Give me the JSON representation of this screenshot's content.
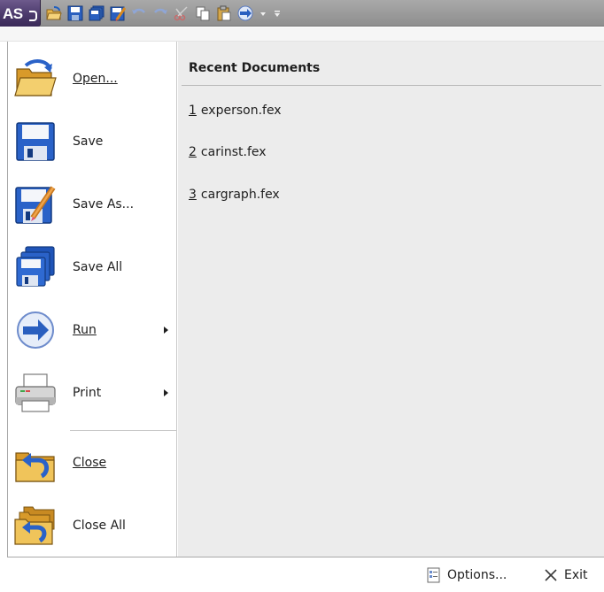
{
  "app": {
    "logo_text": "AS"
  },
  "toolbar": {
    "icons": [
      "open-icon",
      "save-icon",
      "save-all-icon",
      "save-as-icon",
      "undo-icon",
      "redo-icon",
      "cut-icon",
      "copy-icon",
      "paste-icon",
      "run-icon",
      "dropdown-icon",
      "customize-icon"
    ]
  },
  "commands": [
    {
      "id": "open",
      "label": "Open...",
      "mnemonic_index": 0,
      "icon": "folder-open-icon",
      "submenu": false
    },
    {
      "id": "save",
      "label": "Save",
      "mnemonic_index": 0,
      "icon": "floppy-disk-icon",
      "submenu": false
    },
    {
      "id": "save-as",
      "label": "Save As...",
      "mnemonic_index": 5,
      "icon": "save-as-icon",
      "submenu": false
    },
    {
      "id": "save-all",
      "label": "Save All",
      "mnemonic_index": -1,
      "icon": "save-all-icon",
      "submenu": false
    },
    {
      "id": "run",
      "label": "Run",
      "mnemonic_index": 0,
      "icon": "run-arrow-icon",
      "submenu": true
    },
    {
      "id": "print",
      "label": "Print",
      "mnemonic_index": -1,
      "icon": "printer-icon",
      "submenu": true
    },
    {
      "id": "close",
      "label": "Close",
      "mnemonic_index": 0,
      "icon": "close-folder-icon",
      "submenu": false
    },
    {
      "id": "close-all",
      "label": "Close All",
      "mnemonic_index": -1,
      "icon": "close-all-folders-icon",
      "submenu": false
    }
  ],
  "recent": {
    "title": "Recent Documents",
    "items": [
      {
        "num": "1",
        "name": "experson.fex"
      },
      {
        "num": "2",
        "name": "carinst.fex"
      },
      {
        "num": "3",
        "name": "cargraph.fex"
      }
    ]
  },
  "footer": {
    "options_label": "Options...",
    "exit_label": "Exit"
  }
}
